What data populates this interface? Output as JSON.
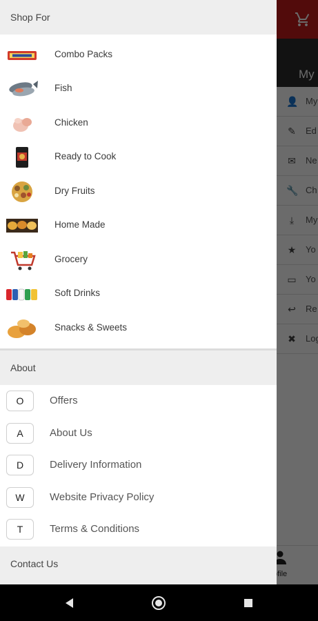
{
  "background": {
    "header_title": "My",
    "rows": [
      {
        "icon": "person-icon",
        "glyph": "👤",
        "label": "My"
      },
      {
        "icon": "pencil-icon",
        "glyph": "✎",
        "label": "Ed"
      },
      {
        "icon": "mail-icon",
        "glyph": "✉",
        "label": "Ne"
      },
      {
        "icon": "wrench-icon",
        "glyph": "🔧",
        "label": "Ch"
      },
      {
        "icon": "download-icon",
        "glyph": "⤓",
        "label": "My"
      },
      {
        "icon": "star-icon",
        "glyph": "★",
        "label": "Yo"
      },
      {
        "icon": "ticket-icon",
        "glyph": "▭",
        "label": "Yo"
      },
      {
        "icon": "reply-icon",
        "glyph": "↩",
        "label": "Re"
      },
      {
        "icon": "close-circle-icon",
        "glyph": "✖",
        "label": "Log"
      }
    ],
    "profile_label": "ofile"
  },
  "drawer": {
    "shop_header": "Shop For",
    "categories": [
      {
        "label": "Combo Packs",
        "thumb": "combo-packs-image"
      },
      {
        "label": "Fish",
        "thumb": "fish-image"
      },
      {
        "label": "Chicken",
        "thumb": "chicken-image"
      },
      {
        "label": "Ready to Cook",
        "thumb": "ready-to-cook-image"
      },
      {
        "label": "Dry Fruits",
        "thumb": "dry-fruits-image"
      },
      {
        "label": "Home Made",
        "thumb": "home-made-image"
      },
      {
        "label": "Grocery",
        "thumb": "grocery-cart-image"
      },
      {
        "label": "Soft Drinks",
        "thumb": "soft-drinks-image"
      },
      {
        "label": "Snacks & Sweets",
        "thumb": "snacks-image"
      }
    ],
    "about_header": "About",
    "about_items": [
      {
        "letter": "O",
        "label": "Offers"
      },
      {
        "letter": "A",
        "label": "About Us"
      },
      {
        "letter": "D",
        "label": "Delivery Information"
      },
      {
        "letter": "W",
        "label": "Website Privacy Policy"
      },
      {
        "letter": "T",
        "label": "Terms & Conditions"
      }
    ],
    "contact_header": "Contact Us"
  },
  "colors": {
    "brand_red": "#c41c1c",
    "header_dark": "#2b2b2b",
    "section_bg": "#eeeeee"
  }
}
